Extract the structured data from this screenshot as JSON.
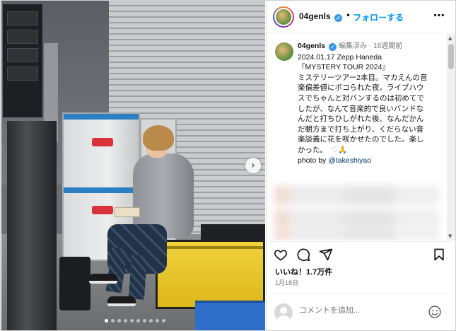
{
  "header": {
    "username": "04genls",
    "separator": "•",
    "follow_label": "フォローする",
    "more_icon": "⋯"
  },
  "caption": {
    "username": "04genls",
    "edited": "編集済み",
    "dot": "·",
    "age": "16週間前",
    "lines": [
      "2024.01.17 Zepp Haneda",
      "『MYSTERY TOUR 2024』",
      "ミステリーツアー2本目。マカえんの音",
      "楽偏差値にボコられた夜。ライブハウ",
      "スでちゃんと対バンするのは初めてで",
      "したが、なんて音楽的で良いバンドな",
      "んだと打ちひしがれた後、なんだかん",
      "だ朝方まで打ち上がり、くだらない音",
      "楽談義に花を咲かせたのでした。楽し",
      "かった。"
    ],
    "emoji_tail": "♡🙏",
    "photo_by_label": "photo by",
    "photo_by_mention": "@takeshiyao"
  },
  "actions": {
    "like_icon": "heart-icon",
    "comment_icon": "comment-icon",
    "share_icon": "share-icon",
    "save_icon": "bookmark-icon"
  },
  "likes": "いいね！1.7万件",
  "date": "1月18日",
  "comment": {
    "placeholder": "コメントを追加..."
  },
  "carousel": {
    "next_glyph": "›",
    "slide_count": 10,
    "active_slide": 1
  },
  "colors": {
    "follow_blue": "#0095f6",
    "verified_blue": "#3897f0",
    "meta_gray": "#737373",
    "mention": "#00376b"
  }
}
